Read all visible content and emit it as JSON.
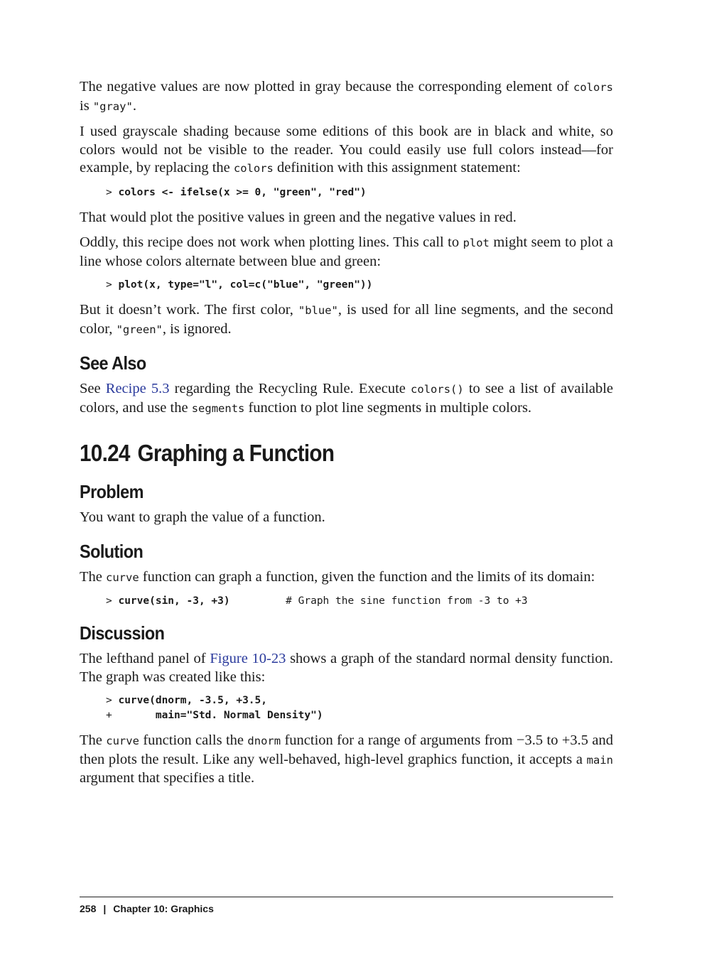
{
  "p1": {
    "t1": "The negative values are now plotted in gray because the corresponding element of ",
    "c1": "colors",
    "t2": " is ",
    "c2": "\"gray\"",
    "t3": "."
  },
  "p2": {
    "t1": "I used grayscale shading because some editions of this book are in black and white, so colors would not be visible to the reader. You could easily use full colors instead—for example, by replacing the ",
    "c1": "colors",
    "t2": " definition with this assignment statement:"
  },
  "code1": {
    "prompt": "> ",
    "cmd": "colors <- ifelse(x >= 0, \"green\", \"red\")"
  },
  "p3": "That would plot the positive values in green and the negative values in red.",
  "p4": {
    "t1": "Oddly, this recipe does not work when plotting lines. This call to ",
    "c1": "plot",
    "t2": " might seem to plot a line whose colors alternate between blue and green:"
  },
  "code2": {
    "prompt": "> ",
    "cmd": "plot(x, type=\"l\", col=c(\"blue\", \"green\"))"
  },
  "p5": {
    "t1": "But it doesn’t work. The first color, ",
    "c1": "\"blue\"",
    "t2": ", is used for all line segments, and the second color, ",
    "c2": "\"green\"",
    "t3": ", is ignored."
  },
  "see_also": {
    "heading": "See Also",
    "t1": "See ",
    "link": "Recipe 5.3",
    "t2": " regarding the Recycling Rule. Execute ",
    "c1": "colors()",
    "t3": " to see a list of available colors, and use the ",
    "c2": "segments",
    "t4": " function to plot line segments in multiple colors."
  },
  "recipe": {
    "number": "10.24",
    "title": "Graphing a Function"
  },
  "problem": {
    "heading": "Problem",
    "text": "You want to graph the value of a function."
  },
  "solution": {
    "heading": "Solution",
    "t1": "The ",
    "c1": "curve",
    "t2": " function can graph a function, given the function and the limits of its domain:",
    "code_prompt": "> ",
    "code_cmd": "curve(sin, -3, +3)",
    "code_comment": "         # Graph the sine function from -3 to +3"
  },
  "discussion": {
    "heading": "Discussion",
    "t1": "The lefthand panel of ",
    "link": "Figure 10-23",
    "t2": " shows a graph of the standard normal density function. The graph was created like this:",
    "code_line1_prompt": "> ",
    "code_line1": "curve(dnorm, -3.5, +3.5,",
    "code_line2_prompt": "+       ",
    "code_line2": "main=\"Std. Normal Density\")",
    "p2_t1": "The ",
    "p2_c1": "curve",
    "p2_t2": " function calls the ",
    "p2_c2": "dnorm",
    "p2_t3": " function for a range of arguments from −3.5 to +3.5 and then plots the result. Like any well-behaved, high-level graphics function, it accepts a ",
    "p2_c3": "main",
    "p2_t4": " argument that specifies a title."
  },
  "footer": {
    "page": "258",
    "sep": "|",
    "chapter": "Chapter 10:  Graphics"
  }
}
